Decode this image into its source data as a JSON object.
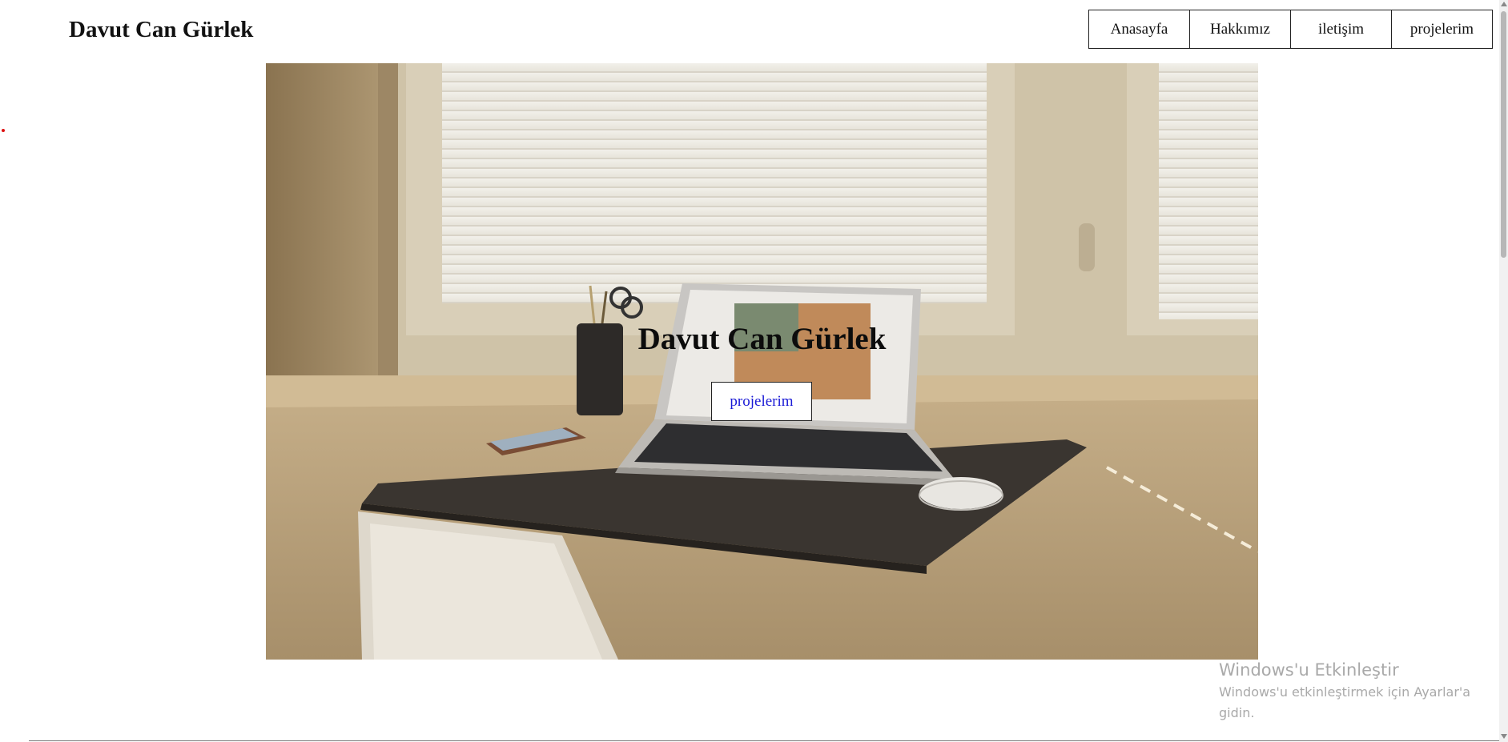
{
  "header": {
    "brand": "Davut Can Gürlek",
    "nav": [
      "Anasayfa",
      "Hakkımız",
      "iletişim",
      "projelerim"
    ]
  },
  "hero": {
    "image_description": "desk-laptop-photo",
    "title": "Davut Can Gürlek",
    "button_label": "projelerim"
  },
  "watermark": {
    "title": "Windows'u Etkinleştir",
    "subtitle": "Windows'u etkinleştirmek için Ayarlar'a gidin."
  },
  "colors": {
    "button_text": "#1a1ad6",
    "border": "#222222",
    "watermark": "#a9a9a9",
    "red_dot": "#dd1111"
  }
}
